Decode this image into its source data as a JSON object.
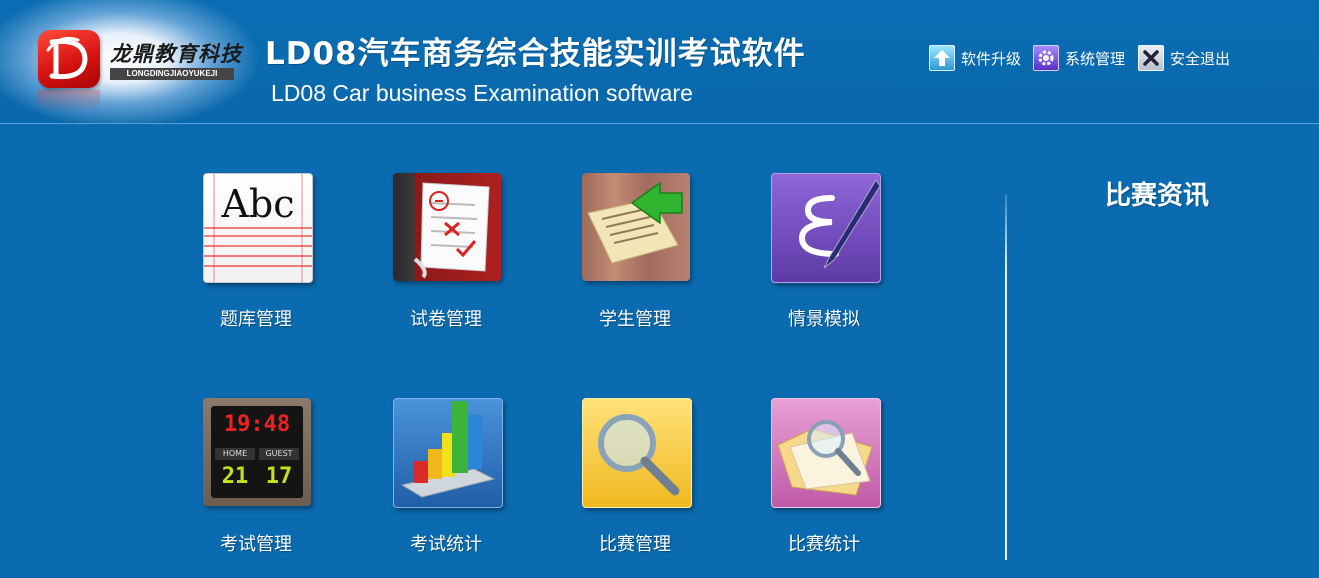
{
  "header": {
    "logo_cn": "龙鼎教育科技",
    "logo_en": "LONGDINGJIAOYUKEJI",
    "title": "LD08汽车商务综合技能实训考试软件",
    "subtitle": "LD08 Car business Examination software"
  },
  "top_actions": [
    {
      "label": "软件升级",
      "icon": "upgrade-arrow-icon"
    },
    {
      "label": "系统管理",
      "icon": "gear-icon"
    },
    {
      "label": "安全退出",
      "icon": "close-x-icon"
    }
  ],
  "tiles": [
    {
      "label": "题库管理",
      "icon": "notebook-abc-icon",
      "icon_text": "Abc"
    },
    {
      "label": "试卷管理",
      "icon": "graded-paper-icon"
    },
    {
      "label": "学生管理",
      "icon": "newspaper-arrow-icon"
    },
    {
      "label": "情景模拟",
      "icon": "pen-script-icon"
    },
    {
      "label": "考试管理",
      "icon": "scoreboard-icon",
      "scoreboard": {
        "time": "19:48",
        "home_label": "HOME",
        "guest_label": "GUEST",
        "home": "21",
        "guest": "17"
      }
    },
    {
      "label": "考试统计",
      "icon": "bar-chart-icon"
    },
    {
      "label": "比赛管理",
      "icon": "magnifier-icon"
    },
    {
      "label": "比赛统计",
      "icon": "folder-search-icon"
    }
  ],
  "news": {
    "title": "比赛资讯"
  },
  "colors": {
    "background": "#0a6bb0",
    "logo_red": "#d41010",
    "text": "#ffffff"
  }
}
